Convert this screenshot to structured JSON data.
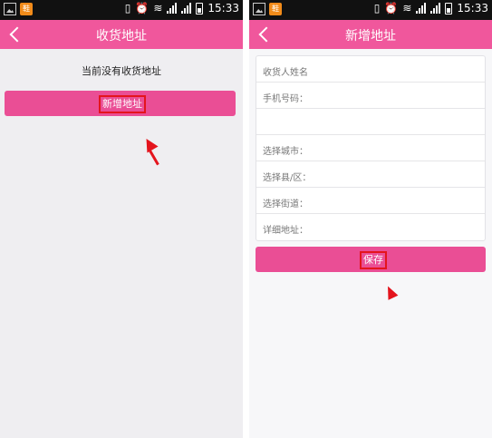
{
  "colors": {
    "accent": "#f0579c",
    "button": "#ea4e95",
    "highlight": "#e4141d"
  },
  "left": {
    "status": {
      "time": "15:33",
      "app_badge": "鞋"
    },
    "title": "收货地址",
    "empty_text": "当前没有收货地址",
    "add_button": "新增地址"
  },
  "right": {
    "status": {
      "time": "15:33",
      "app_badge": "鞋"
    },
    "title": "新增地址",
    "fields": [
      {
        "placeholder": "收货人姓名"
      },
      {
        "placeholder": "手机号码："
      },
      {
        "placeholder": ""
      },
      {
        "placeholder": "选择城市："
      },
      {
        "placeholder": "选择县/区："
      },
      {
        "placeholder": "选择街道："
      },
      {
        "placeholder": "详细地址："
      }
    ],
    "save_button": "保存"
  }
}
